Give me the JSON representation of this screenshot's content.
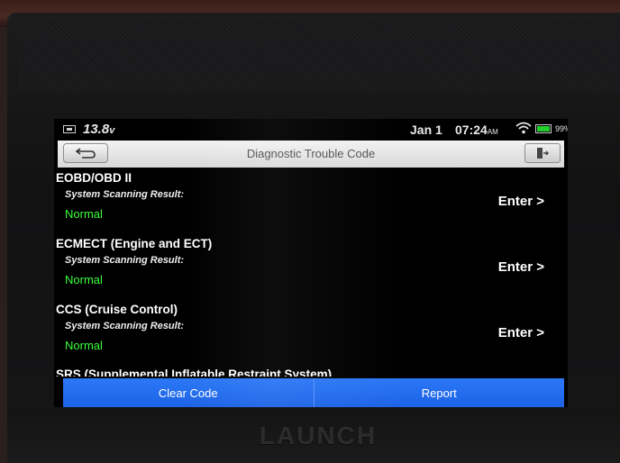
{
  "status_bar": {
    "voltage": "13.8",
    "voltage_unit": "v",
    "date": "Jan 1",
    "time": "07:24",
    "ampm": "AM",
    "battery_percent": "99%",
    "battery_level": 0.99,
    "battery_color": "#23d02b"
  },
  "header": {
    "title": "Diagnostic Trouble Code",
    "back_icon": "back-arrow-icon",
    "exit_icon": "exit-icon"
  },
  "systems": [
    {
      "name": "EOBD/OBD II",
      "scan_label": "System Scanning Result:",
      "status": "Normal",
      "enter_label": "Enter >"
    },
    {
      "name": "ECMECT (Engine and ECT)",
      "scan_label": "System Scanning Result:",
      "status": "Normal",
      "enter_label": "Enter >"
    },
    {
      "name": "CCS (Cruise Control)",
      "scan_label": "System Scanning Result:",
      "status": "Normal",
      "enter_label": "Enter >"
    }
  ],
  "partial_item": "SRS (Supplemental Inflatable Restraint System)",
  "actions": {
    "clear_label": "Clear Code",
    "report_label": "Report"
  },
  "device": {
    "brand": "LAUNCH"
  },
  "colors": {
    "accent": "#1f6ef0",
    "status_normal": "#3bff3b"
  }
}
